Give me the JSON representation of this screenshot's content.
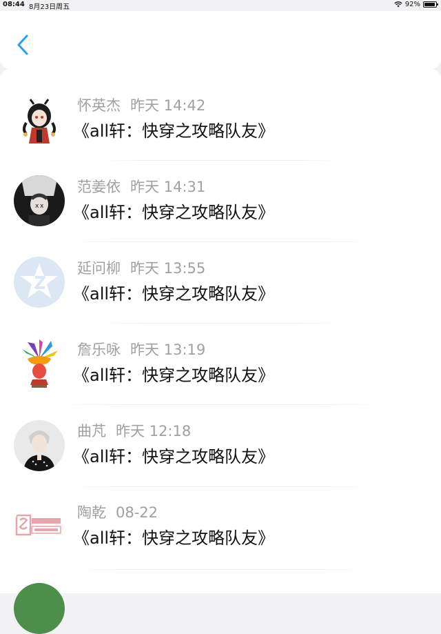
{
  "status_bar": {
    "time": "08:44",
    "date": "8月23日周五",
    "battery": "92%",
    "battery_level": 0.92
  },
  "header": {
    "back_icon": "chevron-left-icon",
    "accent_color": "#2a9df4"
  },
  "items": [
    {
      "name": "怀英杰",
      "time": "昨天 14:42",
      "title": "《all轩：快穿之攻略队友》",
      "avatar_icon": "anime-girl-avatar"
    },
    {
      "name": "范姜依",
      "time": "昨天 14:31",
      "title": "《all轩：快穿之攻略队友》",
      "avatar_icon": "dark-photo-avatar"
    },
    {
      "name": "延问柳",
      "time": "昨天 13:55",
      "title": "《all轩：快穿之攻略队友》",
      "avatar_icon": "default-star-avatar"
    },
    {
      "name": "詹乐咏",
      "time": "昨天 13:19",
      "title": "《all轩：快穿之攻略队友》",
      "avatar_icon": "carnival-mask-avatar"
    },
    {
      "name": "曲芃",
      "time": "昨天 12:18",
      "title": "《all轩：快穿之攻略队友》",
      "avatar_icon": "person-photo-avatar"
    },
    {
      "name": "陶乾",
      "time": "08-22",
      "title": "《all轩：快穿之攻略队友》",
      "avatar_icon": "logo-badge-avatar"
    }
  ]
}
